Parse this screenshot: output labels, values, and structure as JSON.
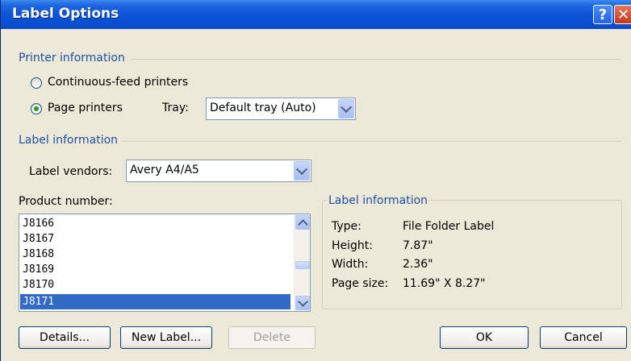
{
  "window": {
    "title": "Label Options"
  },
  "printer_info": {
    "header": "Printer information",
    "continuous_feed_label": "Continuous-feed printers",
    "page_printers_label": "Page printers",
    "selected": "page_printers",
    "tray_label": "Tray:",
    "tray_value": "Default tray (Auto)"
  },
  "label_info_section": {
    "header": "Label information",
    "vendors_label": "Label vendors:",
    "vendors_value": "Avery A4/A5"
  },
  "product": {
    "label": "Product number:",
    "items": [
      "J8166",
      "J8167",
      "J8168",
      "J8169",
      "J8170",
      "J8171"
    ],
    "selected": "J8171"
  },
  "details_panel": {
    "title": "Label information",
    "type_label": "Type:",
    "type_value": "File Folder Label",
    "height_label": "Height:",
    "height_value": "7.87\"",
    "width_label": "Width:",
    "width_value": "2.36\"",
    "page_size_label": "Page size:",
    "page_size_value": "11.69\" X 8.27\""
  },
  "buttons": {
    "details": "Details...",
    "new_label": "New Label...",
    "delete": "Delete",
    "ok": "OK",
    "cancel": "Cancel"
  }
}
